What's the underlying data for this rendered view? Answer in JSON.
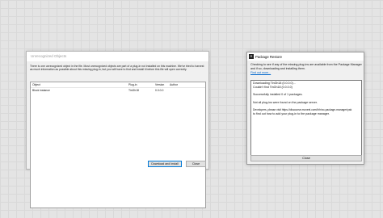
{
  "unrecognized": {
    "title": "Unrecognized Objects",
    "description": "There is one unrecognized object in the file. Most unrecognized objects are part of a plug-in not installed on this machine. We've tried to harvest as much information as possible about this missing plug-in, but you will have to find and install it before this file will open correctly.",
    "columns": [
      "Object",
      "Plug-in",
      "Version",
      "Author"
    ],
    "rows": [
      {
        "object": "Block instance",
        "plugin": "TinGh18",
        "version": "0.0.0.0",
        "author": ""
      }
    ],
    "download_label": "Download and Install",
    "close_label": "Close"
  },
  "restore": {
    "title": "Package Restore",
    "intro": "Checking to see if any of the missing plug-ins are available from the Package Manager and if so, downloading and installing them.",
    "find_more": "Find out more...",
    "log": [
      "Downloading TinGh18 (0.0.0.0)...",
      "Couldn't find TinGh18 (0.0.0.0)",
      "",
      "Successfully installed 0 of 1 packages.",
      "",
      "Not all plug-ins were found on the package server.",
      "",
      "Developers, please visit https://discourse.mcneel.com/t/rhino-package-manager/yak",
      "to find out how to add your plug-in to the package manager."
    ],
    "close_label": "Close"
  }
}
